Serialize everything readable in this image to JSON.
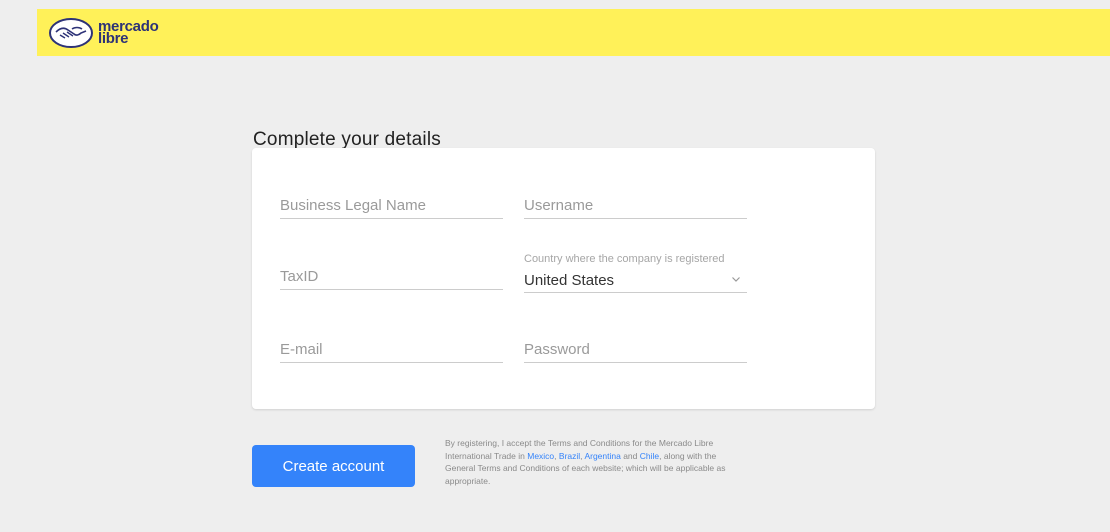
{
  "header": {
    "logo_line1": "mercado",
    "logo_line2": "libre",
    "logo_icon": "handshake-icon",
    "bg_color": "#fff159",
    "logo_color": "#2d3277"
  },
  "page": {
    "title": "Complete your details"
  },
  "form": {
    "business_name_placeholder": "Business Legal Name",
    "username_placeholder": "Username",
    "taxid_placeholder": "TaxID",
    "country_label": "Country where the company is registered",
    "country_value": "United States",
    "email_placeholder": "E-mail",
    "password_placeholder": "Password"
  },
  "actions": {
    "create_account_label": "Create account",
    "accent_color": "#3483fa"
  },
  "terms": {
    "text_1": "By registering, I accept the Terms and Conditions for the Mercado Libre International Trade in ",
    "link_mexico": "Mexico",
    "sep_1": ", ",
    "link_brazil": "Brazil",
    "sep_2": ", ",
    "link_argentina": "Argentina",
    "text_and": " and ",
    "link_chile": "Chile",
    "text_2": ", along with the General Terms and Conditions of each website; which will be applicable as appropriate."
  }
}
